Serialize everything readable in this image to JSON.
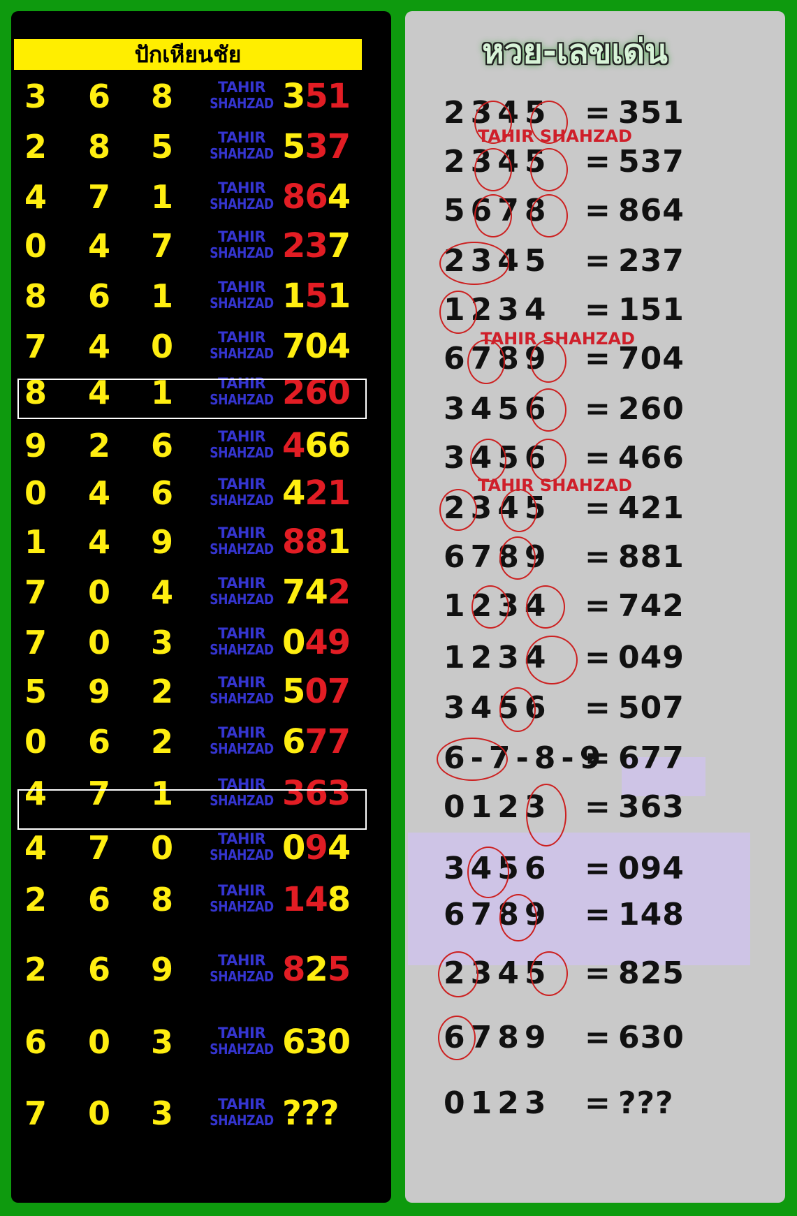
{
  "left": {
    "title": "ปักเหียนชัย",
    "watermark_line1": "TAHIR",
    "watermark_line2": "SHAHZAD",
    "rows": [
      {
        "digits": [
          "3",
          "6",
          "8"
        ],
        "result": [
          [
            "y",
            "3"
          ],
          [
            "r",
            "51"
          ]
        ]
      },
      {
        "digits": [
          "2",
          "8",
          "5"
        ],
        "result": [
          [
            "y",
            "5"
          ],
          [
            "r",
            "37"
          ]
        ]
      },
      {
        "digits": [
          "4",
          "7",
          "1"
        ],
        "result": [
          [
            "r",
            "86"
          ],
          [
            "y",
            "4"
          ]
        ]
      },
      {
        "digits": [
          "0",
          "4",
          "7"
        ],
        "result": [
          [
            "r",
            "23"
          ],
          [
            "y",
            "7"
          ]
        ]
      },
      {
        "digits": [
          "8",
          "6",
          "1"
        ],
        "result": [
          [
            "y",
            "1"
          ],
          [
            "r",
            "5"
          ],
          [
            "y",
            "1"
          ]
        ]
      },
      {
        "digits": [
          "7",
          "4",
          "0"
        ],
        "result": [
          [
            "y",
            "704"
          ]
        ]
      },
      {
        "digits": [
          "8",
          "4",
          "1"
        ],
        "result": [
          [
            "r",
            "260"
          ]
        ]
      },
      {
        "digits": [
          "9",
          "2",
          "6"
        ],
        "result": [
          [
            "r",
            "4"
          ],
          [
            "y",
            "66"
          ]
        ]
      },
      {
        "digits": [
          "0",
          "4",
          "6"
        ],
        "result": [
          [
            "y",
            "4"
          ],
          [
            "r",
            "21"
          ]
        ]
      },
      {
        "digits": [
          "1",
          "4",
          "9"
        ],
        "result": [
          [
            "r",
            "88"
          ],
          [
            "y",
            "1"
          ]
        ]
      },
      {
        "digits": [
          "7",
          "0",
          "4"
        ],
        "result": [
          [
            "y",
            "74"
          ],
          [
            "r",
            "2"
          ]
        ]
      },
      {
        "digits": [
          "7",
          "0",
          "3"
        ],
        "result": [
          [
            "y",
            "0"
          ],
          [
            "r",
            "49"
          ]
        ]
      },
      {
        "digits": [
          "5",
          "9",
          "2"
        ],
        "result": [
          [
            "y",
            "5"
          ],
          [
            "r",
            "07"
          ]
        ]
      },
      {
        "digits": [
          "0",
          "6",
          "2"
        ],
        "result": [
          [
            "y",
            "6"
          ],
          [
            "r",
            "77"
          ]
        ]
      },
      {
        "digits": [
          "4",
          "7",
          "1"
        ],
        "result": [
          [
            "r",
            "363"
          ]
        ]
      },
      {
        "digits": [
          "4",
          "7",
          "0"
        ],
        "result": [
          [
            "y",
            "0"
          ],
          [
            "r",
            "9"
          ],
          [
            "y",
            "4"
          ]
        ]
      },
      {
        "digits": [
          "2",
          "6",
          "8"
        ],
        "result": [
          [
            "r",
            "14"
          ],
          [
            "y",
            "8"
          ]
        ]
      },
      {
        "digits": [
          "2",
          "6",
          "9"
        ],
        "result": [
          [
            "r",
            "8"
          ],
          [
            "y",
            "2"
          ],
          [
            "r",
            "5"
          ]
        ]
      },
      {
        "digits": [
          "6",
          "0",
          "3"
        ],
        "result": [
          [
            "y",
            "630"
          ]
        ]
      },
      {
        "digits": [
          "7",
          "0",
          "3"
        ],
        "result": [
          [
            "q",
            "???"
          ]
        ]
      }
    ]
  },
  "right": {
    "title": "หวย-เลขเด่น",
    "watermark": "TAHIR SHAHZAD",
    "equals": "=",
    "rows": [
      {
        "seq": "2345",
        "value": "351"
      },
      {
        "seq": "2345",
        "value": "537"
      },
      {
        "seq": "5678",
        "value": "864"
      },
      {
        "seq": "2345",
        "value": "237"
      },
      {
        "seq": "1234",
        "value": "151"
      },
      {
        "seq": "6789",
        "value": "704"
      },
      {
        "seq": "3456",
        "value": "260"
      },
      {
        "seq": "3456",
        "value": "466"
      },
      {
        "seq": "2345",
        "value": "421"
      },
      {
        "seq": "6789",
        "value": "881"
      },
      {
        "seq": "1234",
        "value": "742"
      },
      {
        "seq": "1234",
        "value": "049"
      },
      {
        "seq": "3456",
        "value": "507"
      },
      {
        "seq": "6-7-8-9",
        "value": "677"
      },
      {
        "seq": "0123",
        "value": "363"
      },
      {
        "seq": "3456",
        "value": "094"
      },
      {
        "seq": "6789",
        "value": "148"
      },
      {
        "seq": "2345",
        "value": "825"
      },
      {
        "seq": "6789",
        "value": "630"
      },
      {
        "seq": "0123",
        "value": "???"
      }
    ]
  }
}
